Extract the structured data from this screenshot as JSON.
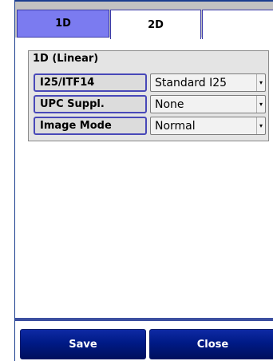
{
  "tabs": [
    {
      "label": "1D",
      "active": true
    },
    {
      "label": "2D",
      "active": false
    }
  ],
  "group": {
    "title": "1D (Linear)",
    "rows": [
      {
        "label": "I25/ITF14",
        "value": "Standard I25"
      },
      {
        "label": "UPC Suppl.",
        "value": "None"
      },
      {
        "label": "Image Mode",
        "value": "Normal"
      }
    ]
  },
  "buttons": {
    "save_label": "Save",
    "close_label": "Close"
  },
  "icons": {
    "dropdown": "dropdown-arrow-icon"
  },
  "colors": {
    "active_tab": "#7b7bf0",
    "button_bg": "#001a86",
    "label_border": "#4848b8"
  }
}
